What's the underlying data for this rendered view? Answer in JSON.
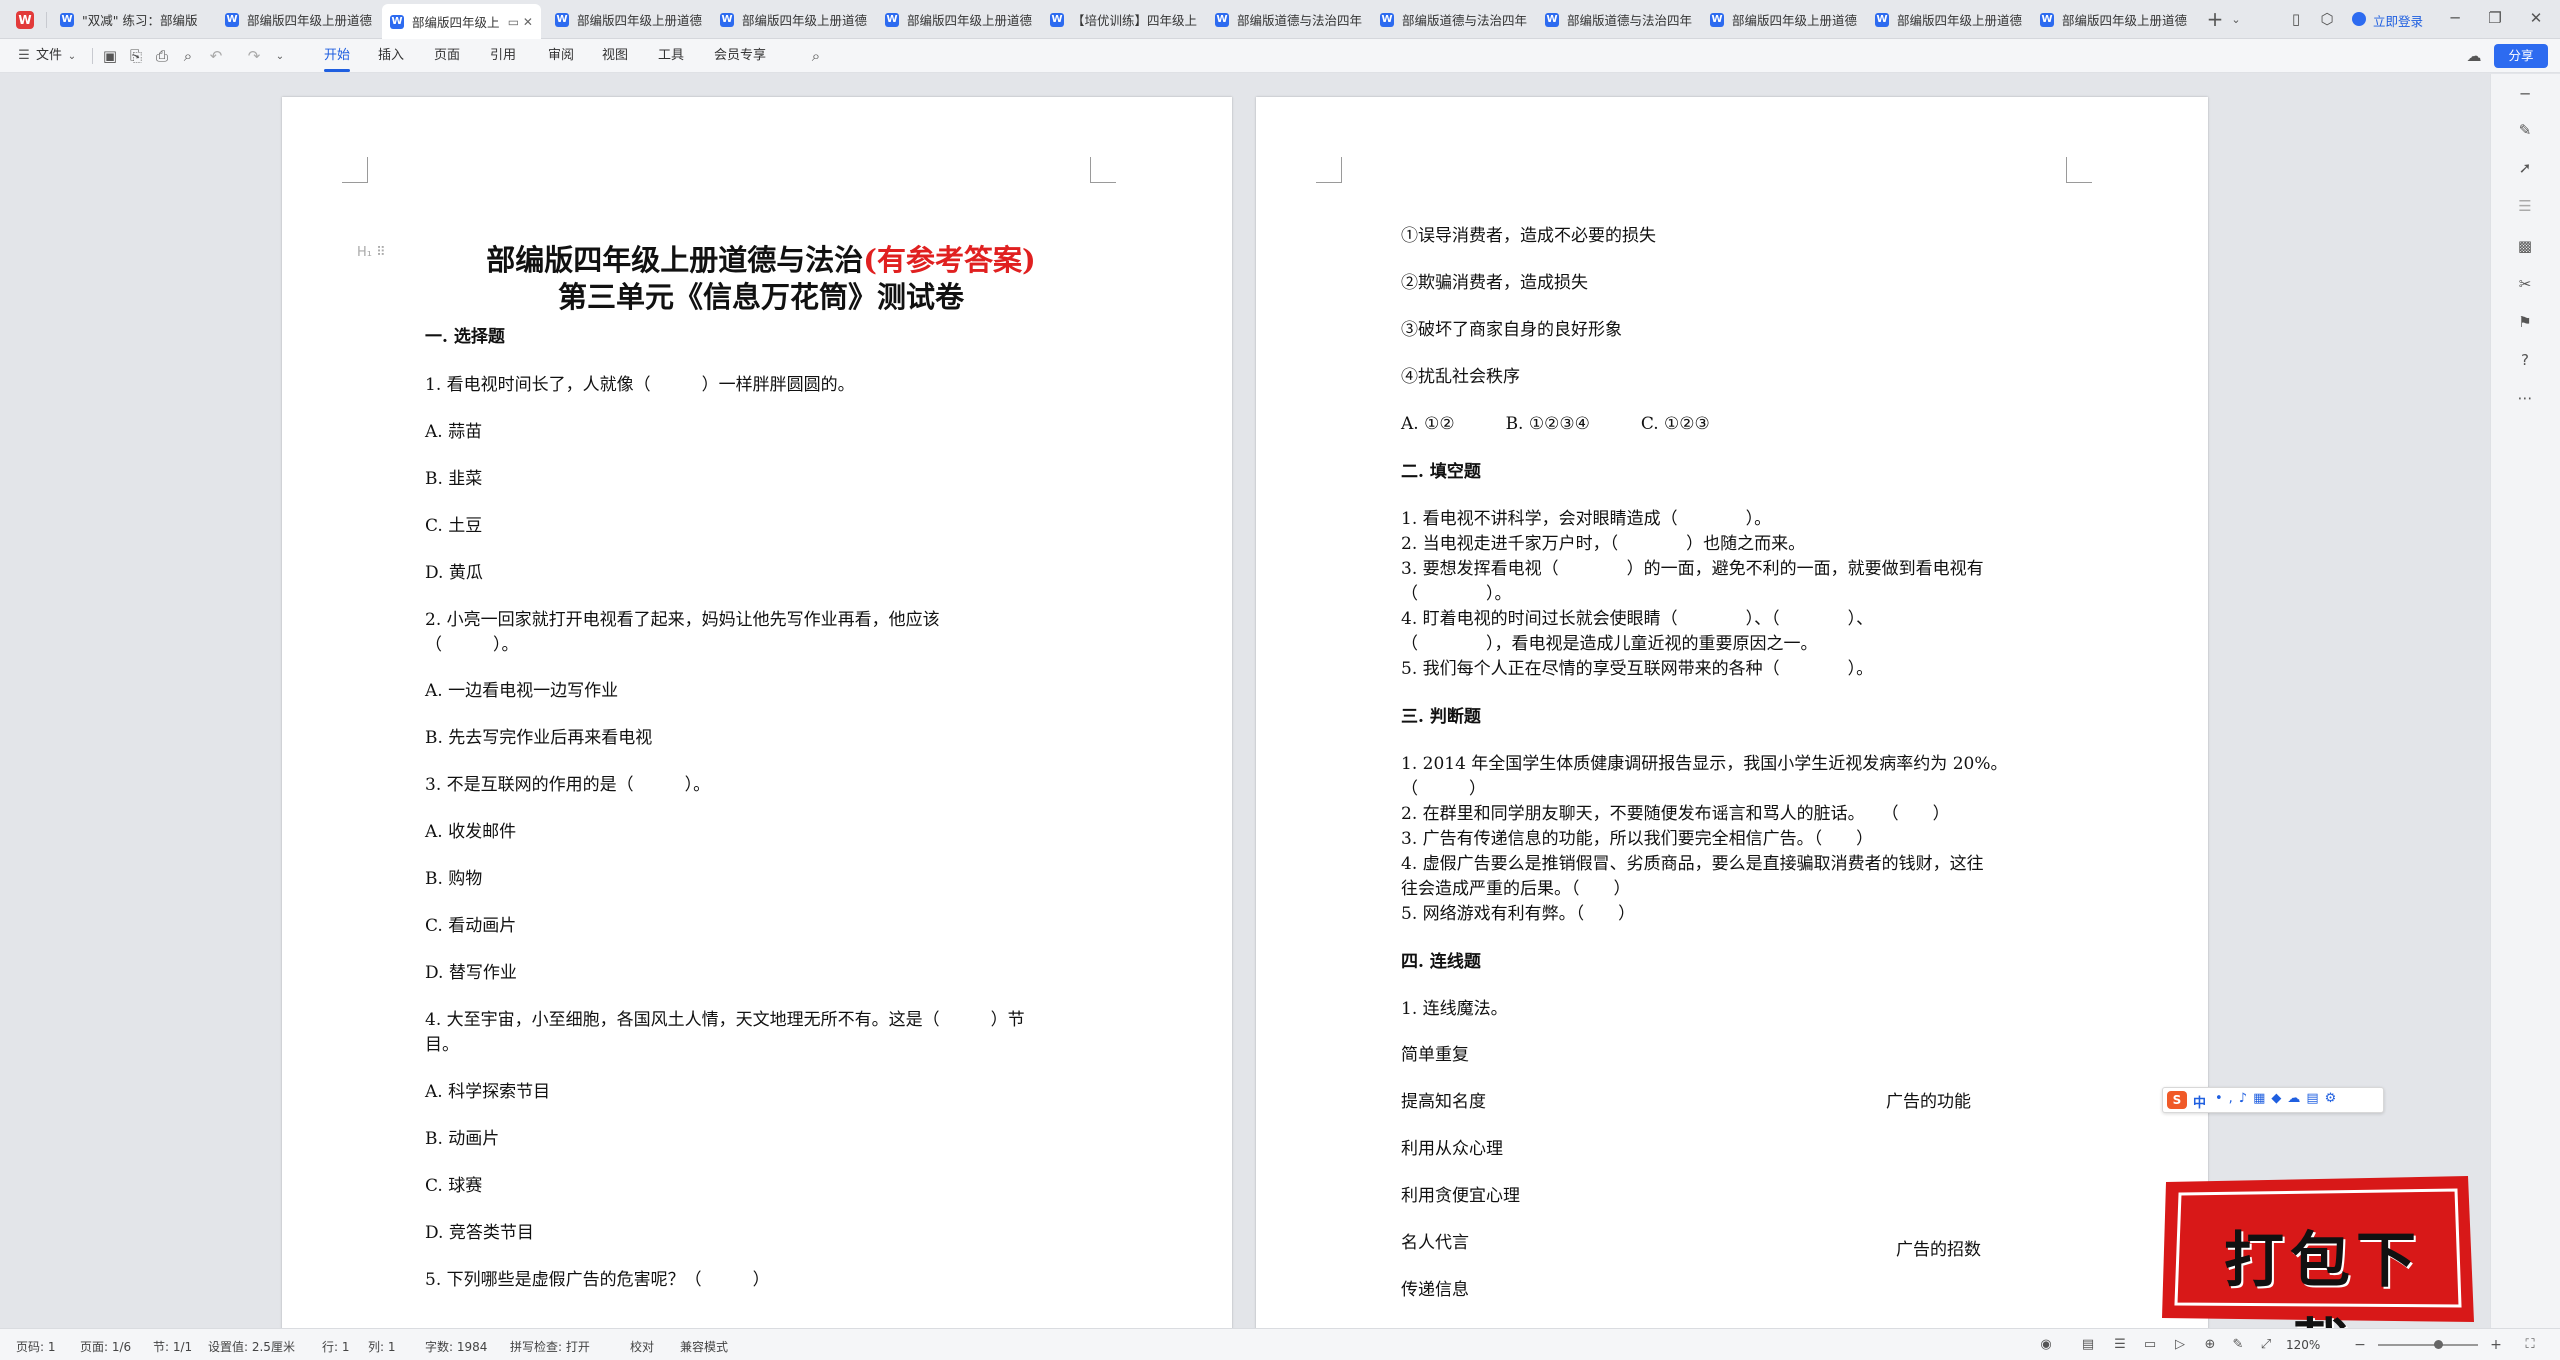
{
  "tabs": [
    {
      "label": "\"双减\" 练习：部编版"
    },
    {
      "label": "部编版四年级上册道德"
    },
    {
      "label": "部编版四年级上"
    },
    {
      "label": "部编版四年级上册道德"
    },
    {
      "label": "部编版四年级上册道德"
    },
    {
      "label": "部编版四年级上册道德"
    },
    {
      "label": "【培优训练】四年级上"
    },
    {
      "label": "部编版道德与法治四年"
    },
    {
      "label": "部编版道德与法治四年"
    },
    {
      "label": "部编版道德与法治四年"
    },
    {
      "label": "部编版四年级上册道德"
    },
    {
      "label": "部编版四年级上册道德"
    },
    {
      "label": "部编版四年级上册道德"
    }
  ],
  "login_label": "立即登录",
  "share_label": "分享",
  "menu": {
    "file": "文件",
    "tabs": [
      "开始",
      "插入",
      "页面",
      "引用",
      "审阅",
      "视图",
      "工具",
      "会员专享"
    ],
    "active": "开始"
  },
  "page1": {
    "title1": "部编版四年级上册道德与法治",
    "title1_red": "(有参考答案)",
    "title2": "第三单元《信息万花筒》测试卷",
    "lines": [
      "一. 选择题",
      "1. 看电视时间长了，人就像（　　　）一样胖胖圆圆的。",
      "A. 蒜苗",
      "B. 韭菜",
      "C. 土豆",
      "D. 黄瓜",
      "2. 小亮一回家就打开电视看了起来，妈妈让他先写作业再看，他应该",
      "（　　　）。",
      "A. 一边看电视一边写作业",
      "B. 先去写完作业后再来看电视",
      "3. 不是互联网的作用的是（　　　）。",
      "A. 收发邮件",
      "B. 购物",
      "C. 看动画片",
      "D. 替写作业",
      "4. 大至宇宙，小至细胞，各国风土人情，天文地理无所不有。这是（　　　）节",
      "目。",
      "A. 科学探索节目",
      "B. 动画片",
      "C. 球赛",
      "D. 竞答类节目",
      "5. 下列哪些是虚假广告的危害呢？（　　　）"
    ]
  },
  "page2": {
    "lines": [
      "①误导消费者，造成不必要的损失",
      "②欺骗消费者，造成损失",
      "③破坏了商家自身的良好形象",
      "④扰乱社会秩序",
      "A. ①②　　　B. ①②③④　　　C. ①②③",
      "二. 填空题",
      "1. 看电视不讲科学，会对眼睛造成（　　　　）。",
      "2. 当电视走进千家万户时，（　　　　）也随之而来。",
      "3. 要想发挥看电视（　　　　）的一面，避免不利的一面，就要做到看电视有",
      "（　　　　）。",
      "4. 盯着电视的时间过长就会使眼睛（　　　　）、（　　　　）、",
      "（　　　　），看电视是造成儿童近视的重要原因之一。",
      "5. 我们每个人正在尽情的享受互联网带来的各种（　　　　）。",
      "三. 判断题",
      "1. 2014 年全国学生体质健康调研报告显示，我国小学生近视发病率约为 20%。",
      "（　　　）",
      "2. 在群里和同学朋友聊天，不要随便发布谣言和骂人的脏话。　　（　　）",
      "3. 广告有传递信息的功能，所以我们要完全相信广告。（　　）",
      "4. 虚假广告要么是推销假冒、劣质商品，要么是直接骗取消费者的钱财，这往",
      "往会造成严重的后果。（　　）",
      "5. 网络游戏有利有弊。（　　）",
      "四. 连线题",
      "1. 连线魔法。",
      "简单重复",
      "提高知名度",
      "利用从众心理",
      "利用贪便宜心理",
      "名人代言",
      "传递信息"
    ],
    "right_labels": [
      "广告的功能",
      "广告的招数"
    ]
  },
  "status": {
    "page": "页码: 1",
    "pages": "页面: 1/6",
    "section": "节: 1/1",
    "setting": "设置值: 2.5厘米",
    "row": "行: 1",
    "col": "列: 1",
    "words": "字数: 1984",
    "spell": "拼写检查: 打开",
    "proof": "校对",
    "compat": "兼容模式",
    "zoom": "120%"
  },
  "ime": {
    "lang": "中"
  },
  "banner": {
    "text": "打包下载"
  },
  "colors": {
    "accent": "#1f5fe0",
    "red": "#e02020"
  }
}
